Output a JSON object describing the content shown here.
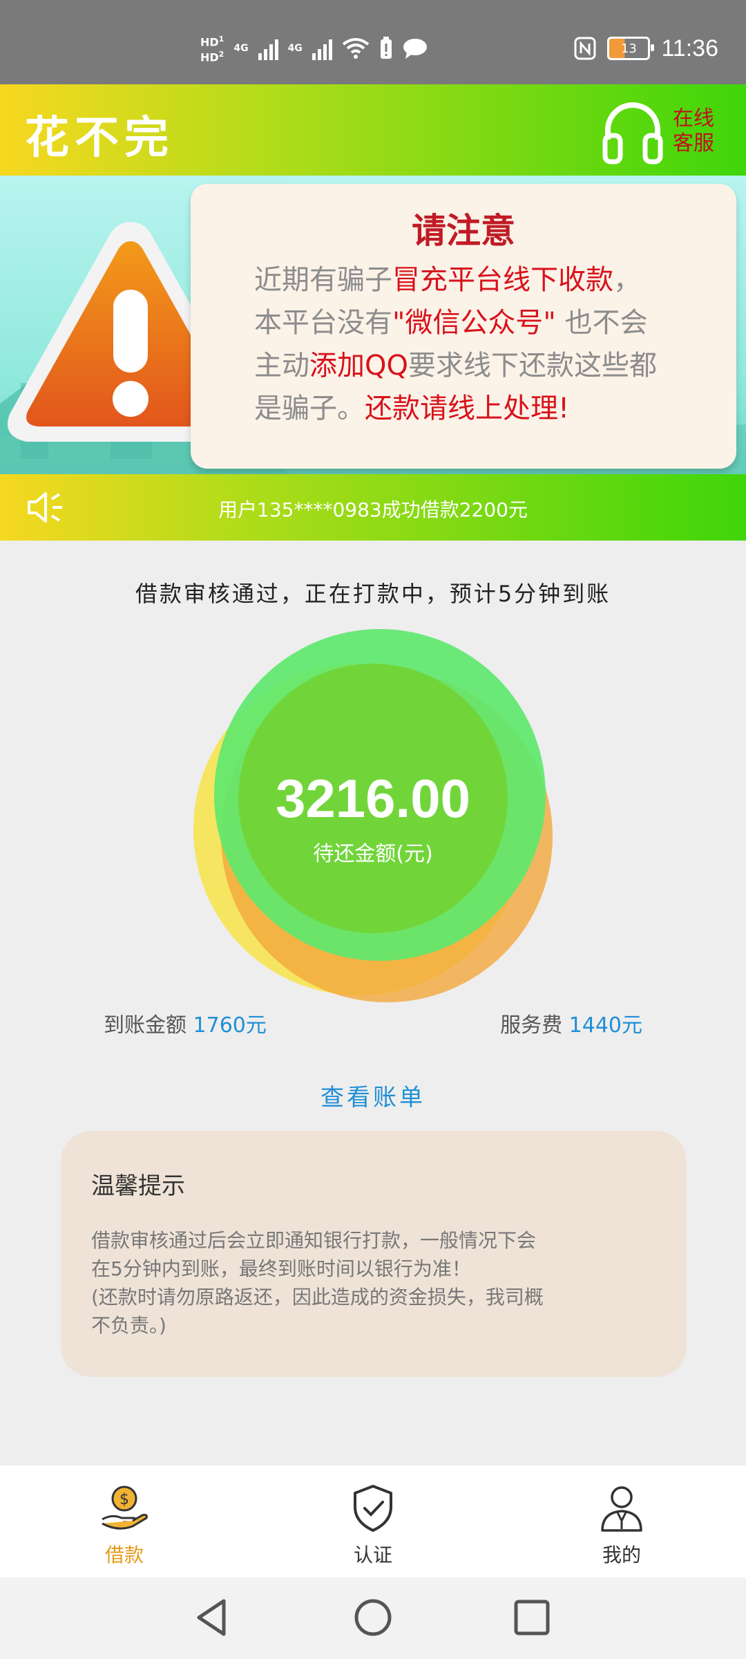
{
  "status_bar": {
    "hd1": "HD",
    "hd2": "HD",
    "sim1": "1",
    "sim2": "2",
    "net1": "4G",
    "net2": "4G",
    "battery_level": "13",
    "time": "11:36"
  },
  "header": {
    "title": "花不完",
    "customer_service_line1": "在线",
    "customer_service_line2": "客服"
  },
  "banner": {
    "title": "请注意",
    "line1_gray": "近期有骗子",
    "line1_red": "冒充平台线下收款",
    "line1_end": "，",
    "line2_a": "本平台没有",
    "line2_red": "\"微信公众号\"",
    "line2_b": " 也不会",
    "line3_a": "主动",
    "line3_red": "添加QQ",
    "line3_b": "要求线下还款这些都",
    "line4_a": "是骗子。",
    "line4_red": "还款请线上处理!"
  },
  "ticker": {
    "text": "用户135****0983成功借款2200元"
  },
  "loan": {
    "status_message": "借款审核通过，正在打款中，预计5分钟到账",
    "amount": "3216.00",
    "amount_label": "待还金额(元)",
    "received_label": "到账金额",
    "received_value": "1760元",
    "fee_label": "服务费",
    "fee_value": "1440元",
    "view_bill": "查看账单"
  },
  "tips": {
    "title": "温馨提示",
    "body_line1": "借款审核通过后会立即通知银行打款，一般情况下会",
    "body_line2": "在5分钟内到账，最终到账时间以银行为准！",
    "body_line3": "(还款时请勿原路返还，因此造成的资金损失，我司概",
    "body_line4": "不负责。)"
  },
  "tabs": [
    {
      "label": "借款",
      "icon": "money-hand-icon",
      "active": true
    },
    {
      "label": "认证",
      "icon": "shield-check-icon",
      "active": false
    },
    {
      "label": "我的",
      "icon": "person-icon",
      "active": false
    }
  ],
  "colors": {
    "brand_green": "#3fd60a",
    "brand_yellow": "#f7d820",
    "warning_red": "#d8121b",
    "link_blue": "#1f8fd6",
    "active_tab": "#e39a16"
  }
}
